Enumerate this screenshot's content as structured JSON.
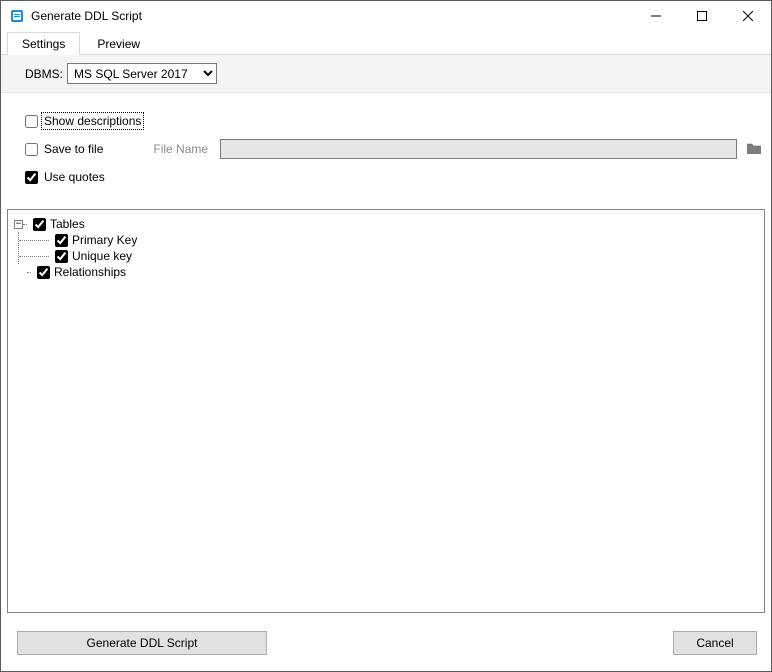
{
  "window": {
    "title": "Generate DDL Script"
  },
  "tabs": {
    "settings": "Settings",
    "preview": "Preview"
  },
  "dbms": {
    "label": "DBMS:",
    "value": "MS SQL Server 2017"
  },
  "options": {
    "show_descriptions": {
      "label": "Show descriptions",
      "checked": false
    },
    "save_to_file": {
      "label": "Save to file",
      "checked": false
    },
    "file_name_label": "File Name",
    "file_name_value": "",
    "use_quotes": {
      "label": "Use quotes",
      "checked": true
    }
  },
  "tree": {
    "tables": {
      "label": "Tables",
      "checked": true,
      "expanded": true,
      "children": {
        "primary_key": {
          "label": "Primary Key",
          "checked": true
        },
        "unique_key": {
          "label": "Unique key",
          "checked": true
        }
      }
    },
    "relationships": {
      "label": "Relationships",
      "checked": true
    }
  },
  "footer": {
    "generate": "Generate DDL Script",
    "cancel": "Cancel"
  }
}
